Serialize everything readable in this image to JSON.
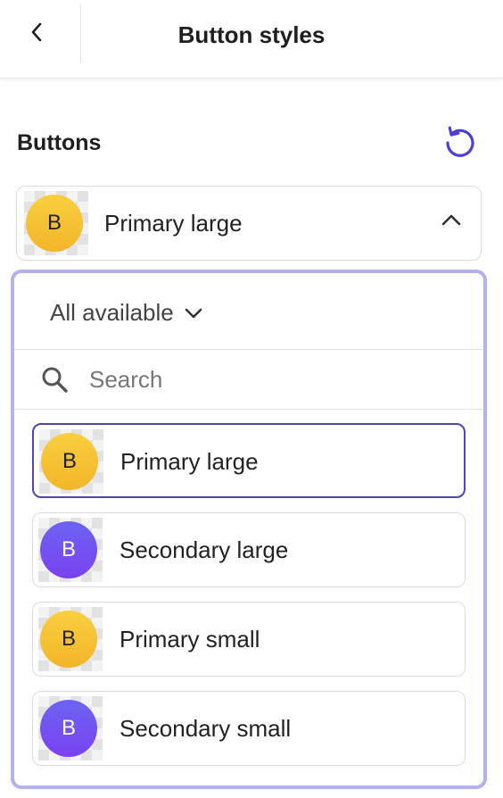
{
  "header": {
    "title": "Button styles"
  },
  "section": {
    "title": "Buttons"
  },
  "selector": {
    "badge_letter": "B",
    "label": "Primary large"
  },
  "dropdown": {
    "filter_label": "All available",
    "search_placeholder": "Search",
    "options": [
      {
        "badge_letter": "B",
        "label": "Primary large",
        "color": "yellow"
      },
      {
        "badge_letter": "B",
        "label": "Secondary large",
        "color": "purple"
      },
      {
        "badge_letter": "B",
        "label": "Primary small",
        "color": "yellow"
      },
      {
        "badge_letter": "B",
        "label": "Secondary small",
        "color": "purple"
      }
    ]
  },
  "colors": {
    "accent": "#4e46b7",
    "focus_ring": "#b3b1ee",
    "primary_badge": "#f5c233",
    "secondary_badge": "#7250f2"
  }
}
